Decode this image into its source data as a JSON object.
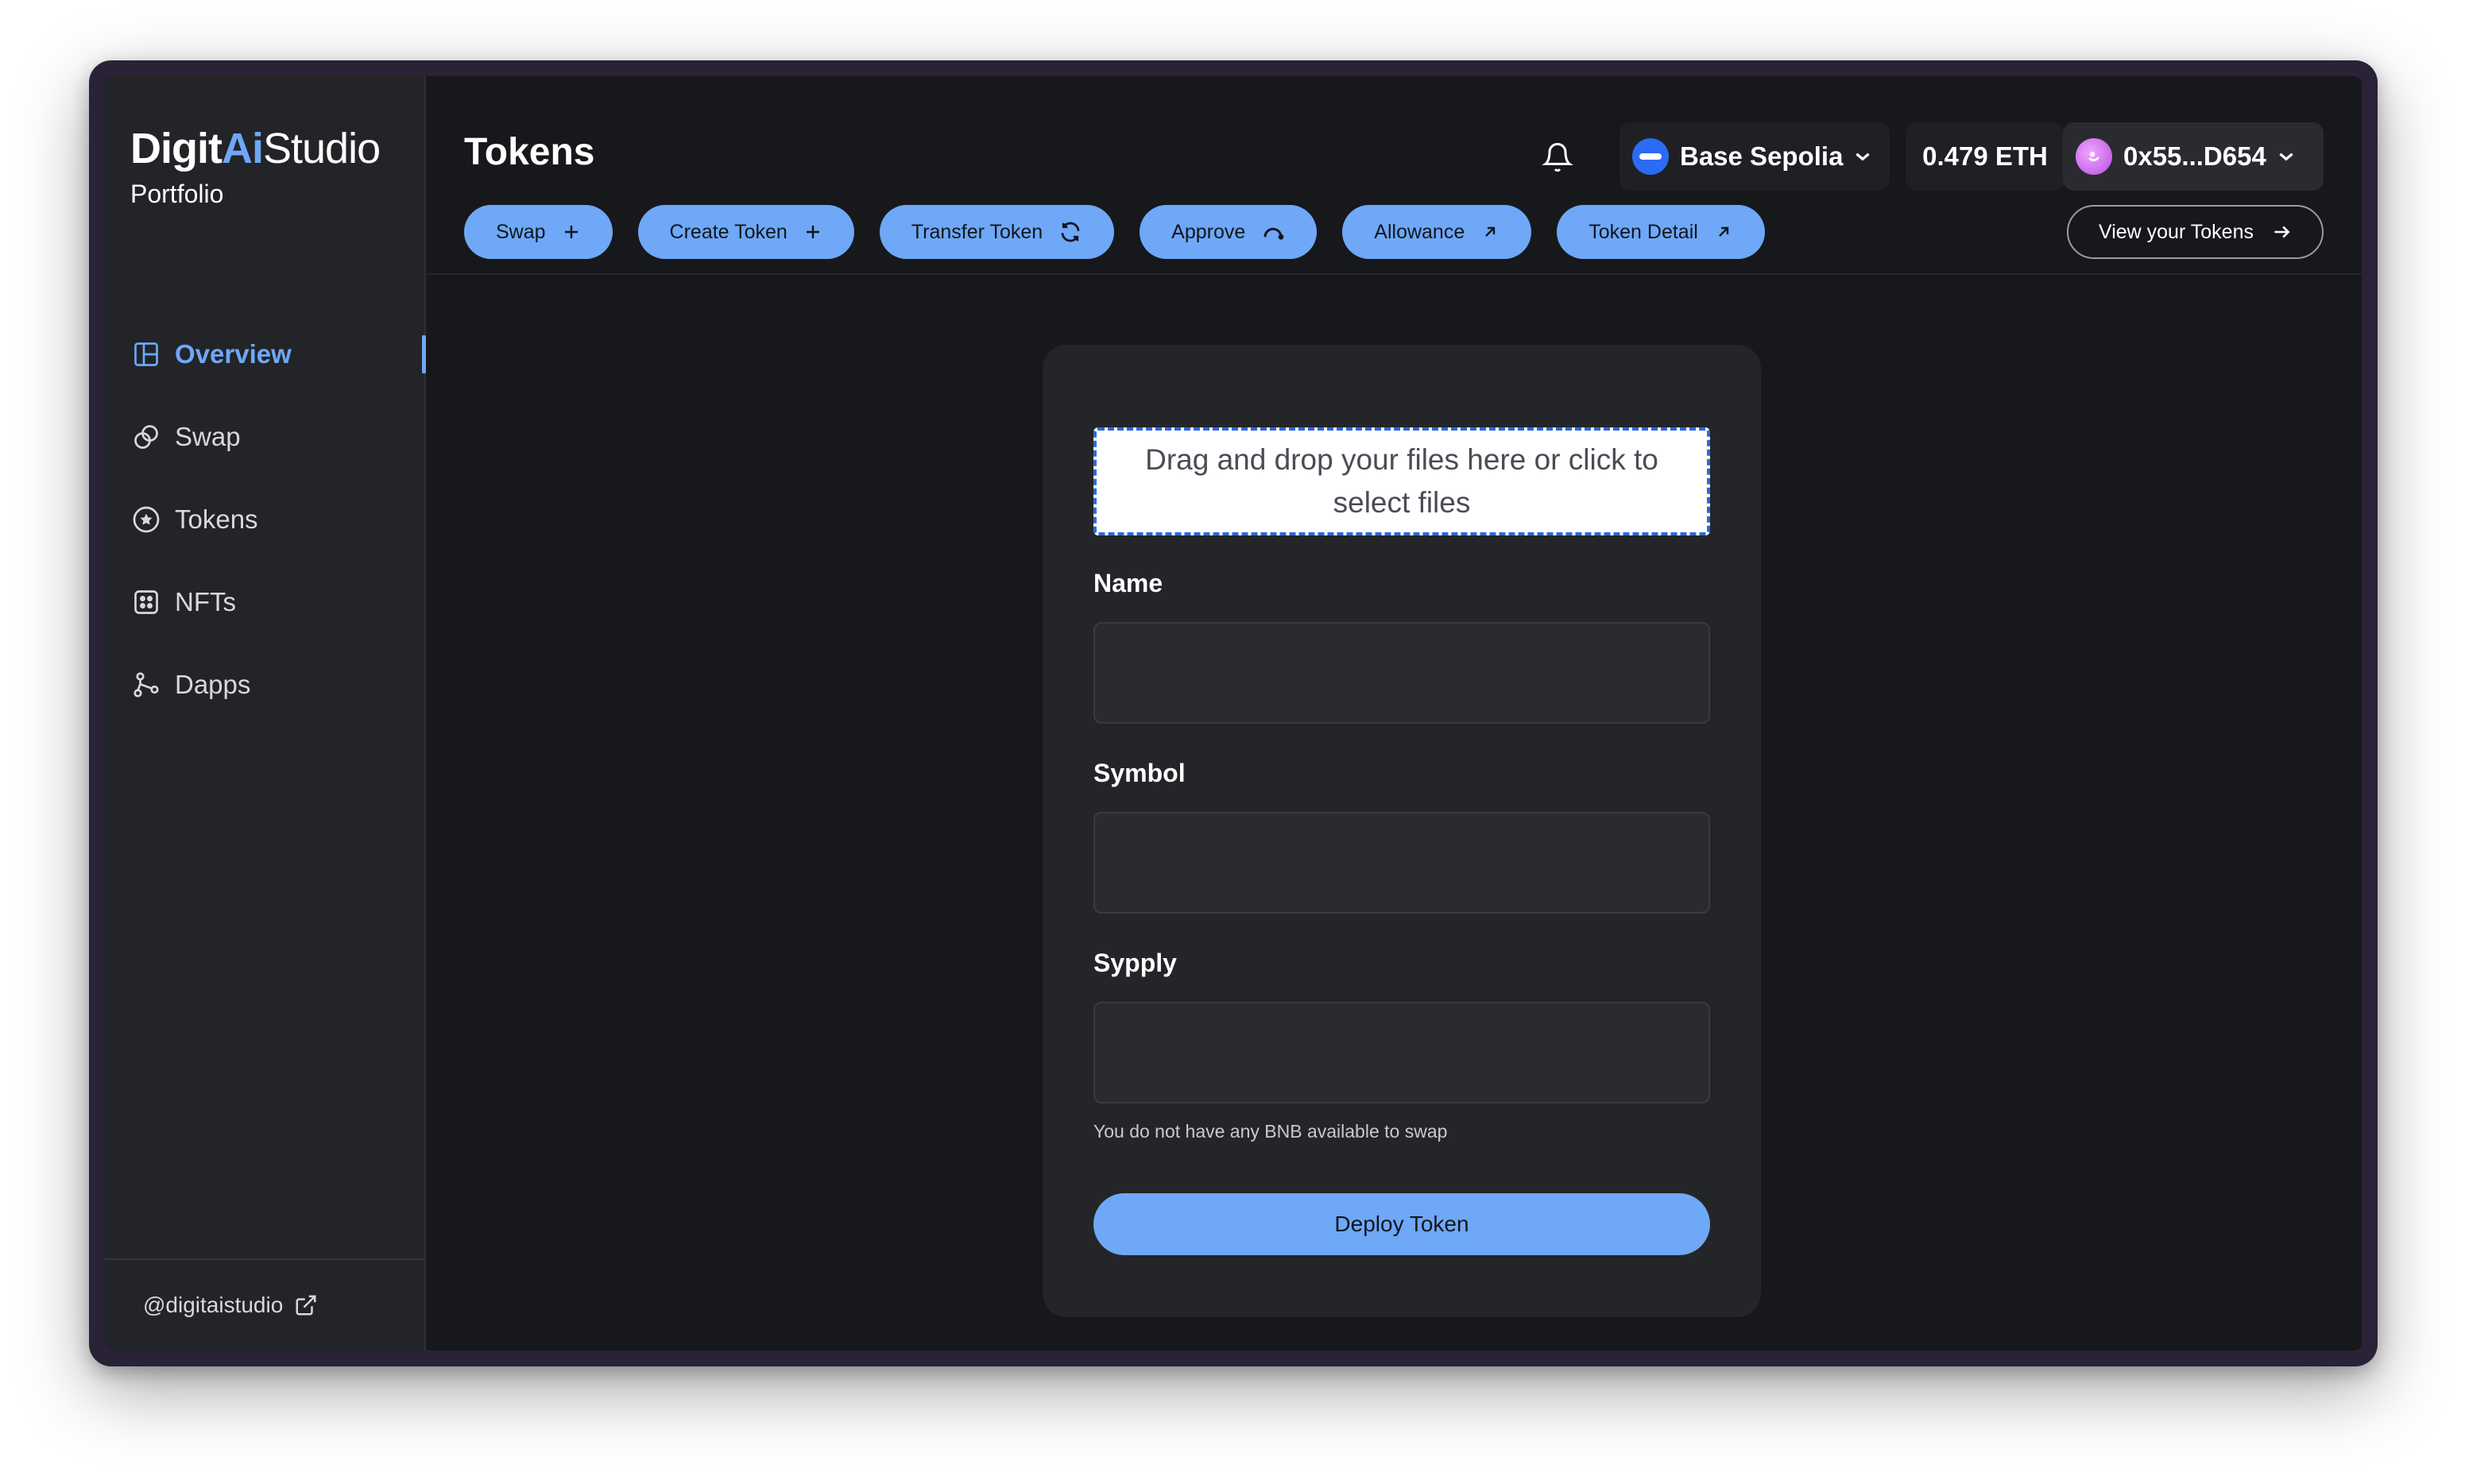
{
  "brand": {
    "part1": "Digit",
    "part2": "Ai",
    "part3": "Studio",
    "subtitle": "Portfolio"
  },
  "sidebar": {
    "items": [
      {
        "label": "Overview",
        "icon": "layout-icon",
        "active": true
      },
      {
        "label": "Swap",
        "icon": "swap-icon"
      },
      {
        "label": "Tokens",
        "icon": "star-coin-icon"
      },
      {
        "label": "NFTs",
        "icon": "grid-icon"
      },
      {
        "label": "Dapps",
        "icon": "nodes-icon"
      }
    ],
    "footer": "@digitaistudio"
  },
  "header": {
    "title": "Tokens",
    "network": "Base Sepolia",
    "balance": "0.479 ETH",
    "account": "0x55...D654"
  },
  "actions": [
    {
      "label": "Swap",
      "icon": "plus-icon"
    },
    {
      "label": "Create Token",
      "icon": "plus-icon"
    },
    {
      "label": "Transfer Token",
      "icon": "refresh-icon"
    },
    {
      "label": "Approve",
      "icon": "arc-icon"
    },
    {
      "label": "Allowance",
      "icon": "arrow-up-right-icon"
    },
    {
      "label": "Token Detail",
      "icon": "arrow-up-right-icon"
    }
  ],
  "view_tokens": "View your Tokens",
  "form": {
    "dropzone": "Drag and drop your files here or click to select files",
    "name_label": "Name",
    "name_value": "",
    "symbol_label": "Symbol",
    "symbol_value": "",
    "supply_label": "Sypply",
    "supply_value": "",
    "hint": "You do not have any BNB available to swap",
    "deploy_label": "Deploy Token"
  },
  "colors": {
    "accent": "#6ea8f7",
    "background": "#17181b",
    "sidebar": "#232428",
    "card": "#242529",
    "frame": "#2a2236"
  }
}
